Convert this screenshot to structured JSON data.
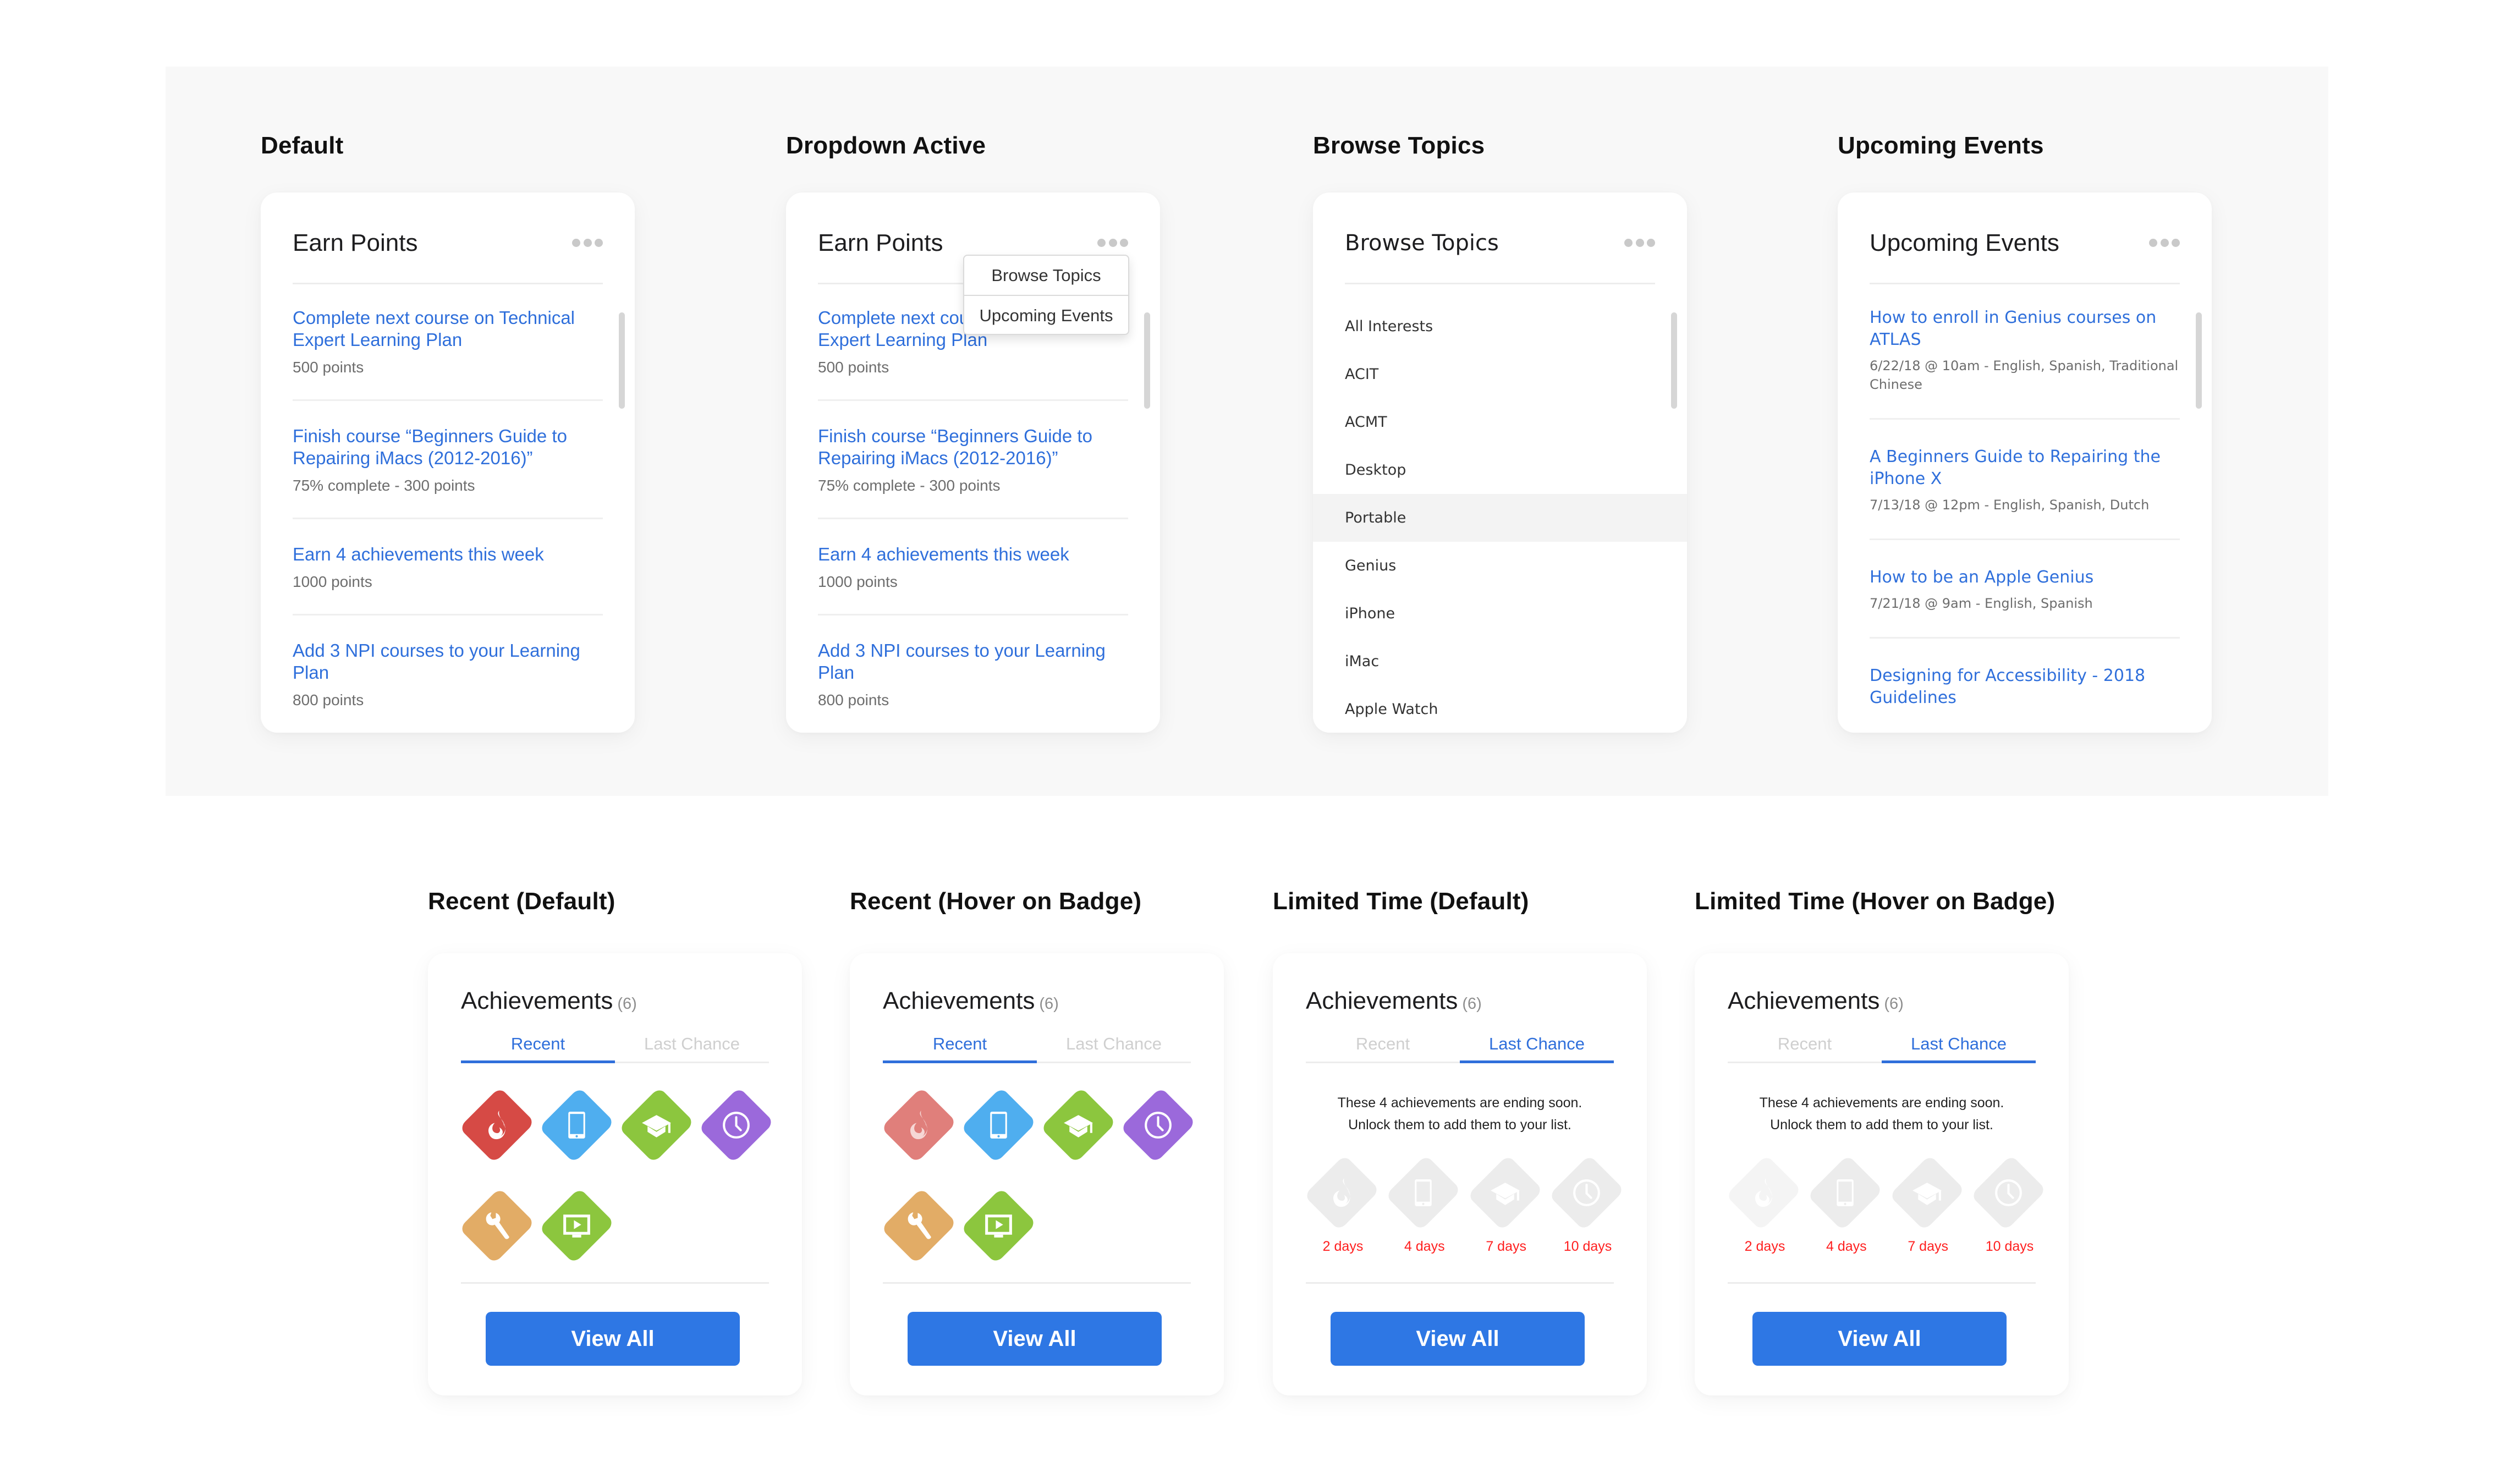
{
  "top_section": {
    "states": [
      {
        "label": "Default"
      },
      {
        "label": "Dropdown Active"
      },
      {
        "label": "Browse Topics"
      },
      {
        "label": "Upcoming Events"
      }
    ]
  },
  "earn_points": {
    "title": "Earn Points",
    "items": [
      {
        "title": "Complete next course on Technical Expert Learning Plan",
        "sub": "500 points"
      },
      {
        "title": "Finish course “Beginners Guide to Repairing iMacs (2012-2016)”",
        "sub": "75% complete - 300 points"
      },
      {
        "title": "Earn 4 achievements this week",
        "sub": "1000 points"
      },
      {
        "title": "Add 3 NPI courses to your Learning Plan",
        "sub": "800 points"
      }
    ]
  },
  "dropdown": {
    "items": [
      {
        "label": "Browse Topics"
      },
      {
        "label": "Upcoming Events"
      }
    ]
  },
  "browse_topics": {
    "title": "Browse Topics",
    "hovered": "Portable",
    "items": [
      "All Interests",
      "ACIT",
      "ACMT",
      "Desktop",
      "Portable",
      "Genius",
      "iPhone",
      "iMac",
      "Apple Watch"
    ]
  },
  "upcoming_events": {
    "title": "Upcoming Events",
    "items": [
      {
        "title": "How to enroll in Genius courses on ATLAS",
        "sub": "6/22/18 @ 10am - English, Spanish, Traditional Chinese"
      },
      {
        "title": "A Beginners Guide to Repairing the iPhone X",
        "sub": "7/13/18 @ 12pm - English, Spanish, Dutch"
      },
      {
        "title": "How to be an Apple Genius",
        "sub": "7/21/18 @ 9am - English, Spanish"
      },
      {
        "title": "Designing for Accessibility - 2018 Guidelines",
        "sub": ""
      }
    ]
  },
  "bottom_section": {
    "states": [
      {
        "label": "Recent (Default)"
      },
      {
        "label": "Recent (Hover on Badge)"
      },
      {
        "label": "Limited Time (Default)"
      },
      {
        "label": "Limited Time (Hover on Badge)"
      }
    ]
  },
  "achievements": {
    "title": "Achievements",
    "count": "(6)",
    "tabs": {
      "recent": "Recent",
      "last_chance": "Last Chance"
    },
    "badges": [
      {
        "icon": "flame-icon",
        "color": "#d64a45"
      },
      {
        "icon": "tablet-icon",
        "color": "#4faeef"
      },
      {
        "icon": "graduation-cap-icon",
        "color": "#8cc63e"
      },
      {
        "icon": "clock-icon",
        "color": "#9b69db"
      },
      {
        "icon": "wrench-icon",
        "color": "#e2ac66"
      },
      {
        "icon": "video-icon",
        "color": "#8cc63e"
      }
    ],
    "hover_badge_color": "#e07f7b",
    "last_chance_text_1": "These 4 achievements are ending soon.",
    "last_chance_text_2": "Unlock them to add them to your list.",
    "last_chance_badges": [
      {
        "icon": "flame-icon",
        "days": "2 days"
      },
      {
        "icon": "tablet-icon",
        "days": "4 days"
      },
      {
        "icon": "graduation-cap-icon",
        "days": "7 days"
      },
      {
        "icon": "clock-icon",
        "days": "10 days"
      }
    ],
    "locked_color": "#ececec",
    "locked_hover_color": "#f4f4f4",
    "view_all_label": "View All"
  },
  "colors": {
    "accent": "#2f6fdb",
    "button": "#2e77e4",
    "danger": "#ff1f1f"
  }
}
